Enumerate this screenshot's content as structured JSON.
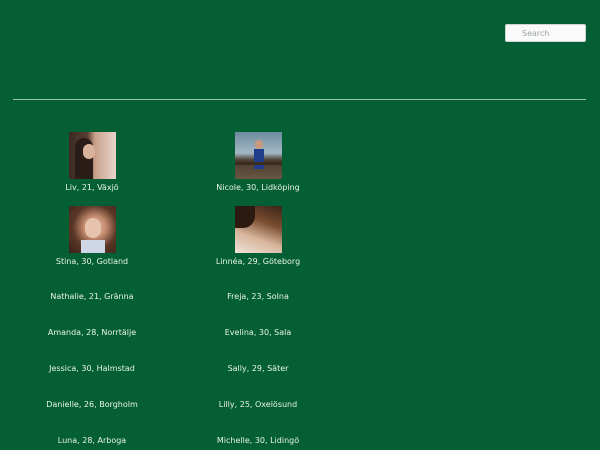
{
  "search": {
    "placeholder": "Search"
  },
  "profiles": [
    {
      "caption": "Liv, 21, Växjö"
    },
    {
      "caption": "Nicole, 30, Lidköping"
    },
    {
      "caption": "Stina, 30, Gotland"
    },
    {
      "caption": "Linnéa, 29, Göteborg"
    },
    {
      "caption": "Nathalie, 21, Gränna"
    },
    {
      "caption": "Freja, 23, Solna"
    },
    {
      "caption": "Amanda, 28, Norrtälje"
    },
    {
      "caption": "Evelina, 30, Sala"
    },
    {
      "caption": "Jessica, 30, Halmstad"
    },
    {
      "caption": "Sally, 29, Säter"
    },
    {
      "caption": "Danielle, 26, Borgholm"
    },
    {
      "caption": "Lilly, 25, Oxelösund"
    },
    {
      "caption": "Luna, 28, Arboga"
    },
    {
      "caption": "Michelle, 30, Lidingö"
    }
  ],
  "colors": {
    "background": "#055f35",
    "text": "#e9f3ec",
    "divider": "#9fc3ad"
  }
}
